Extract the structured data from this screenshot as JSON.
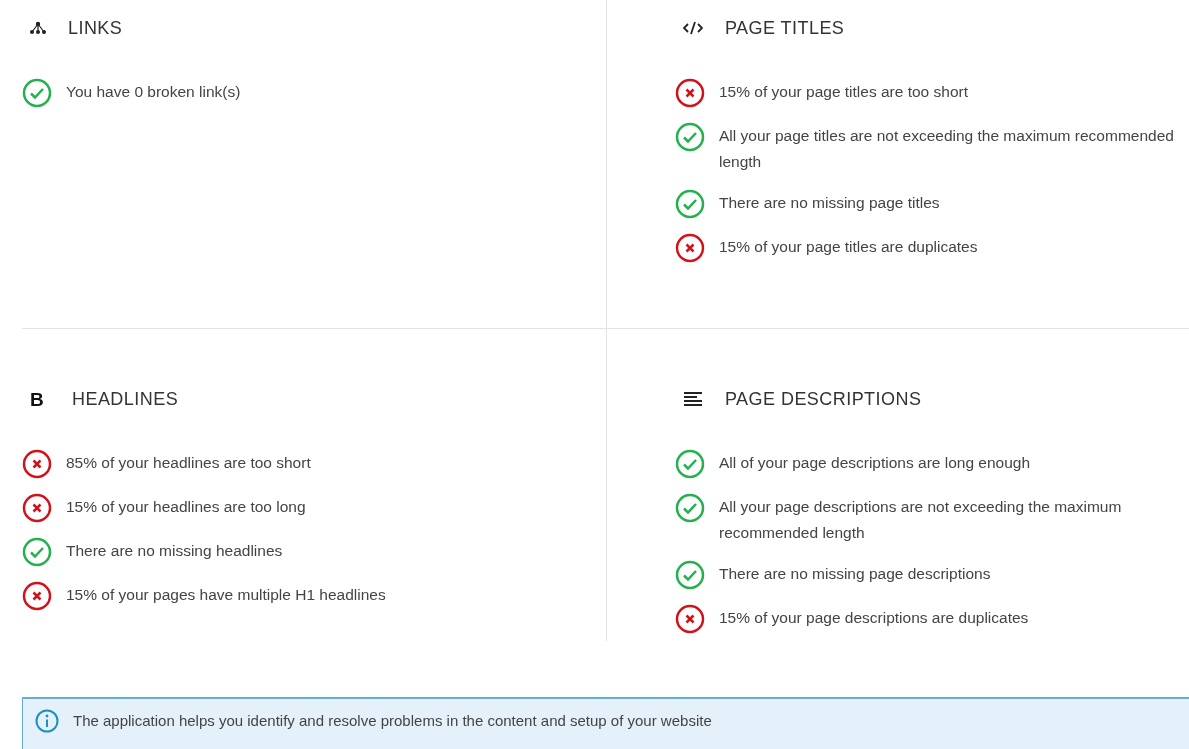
{
  "sections": [
    {
      "kind": "links",
      "title": "LINKS",
      "checks": [
        {
          "passed": true,
          "text": "You have 0 broken link(s)"
        }
      ]
    },
    {
      "kind": "code",
      "title": "PAGE TITLES",
      "checks": [
        {
          "passed": false,
          "text": "15% of your page titles are too short"
        },
        {
          "passed": true,
          "text": "All your page titles are not exceeding the maximum recommended length"
        },
        {
          "passed": true,
          "text": "There are no missing page titles"
        },
        {
          "passed": false,
          "text": "15% of your page titles are duplicates"
        }
      ]
    },
    {
      "kind": "letter",
      "glyph": "B",
      "title": "HEADLINES",
      "checks": [
        {
          "passed": false,
          "text": "85% of your headlines are too short"
        },
        {
          "passed": false,
          "text": "15% of your headlines are too long"
        },
        {
          "passed": true,
          "text": "There are no missing headlines"
        },
        {
          "passed": false,
          "text": "15% of your pages have multiple H1 headlines"
        }
      ]
    },
    {
      "kind": "lines",
      "title": "PAGE DESCRIPTIONS",
      "checks": [
        {
          "passed": true,
          "text": "All of your page descriptions are long enough"
        },
        {
          "passed": true,
          "text": "All your page descriptions are not exceeding the maximum recommended length"
        },
        {
          "passed": true,
          "text": "There are no missing page descriptions"
        },
        {
          "passed": false,
          "text": "15% of your page descriptions are duplicates"
        }
      ]
    }
  ],
  "info": {
    "text": "The application helps you identify and resolve problems in the content and setup of your website"
  }
}
